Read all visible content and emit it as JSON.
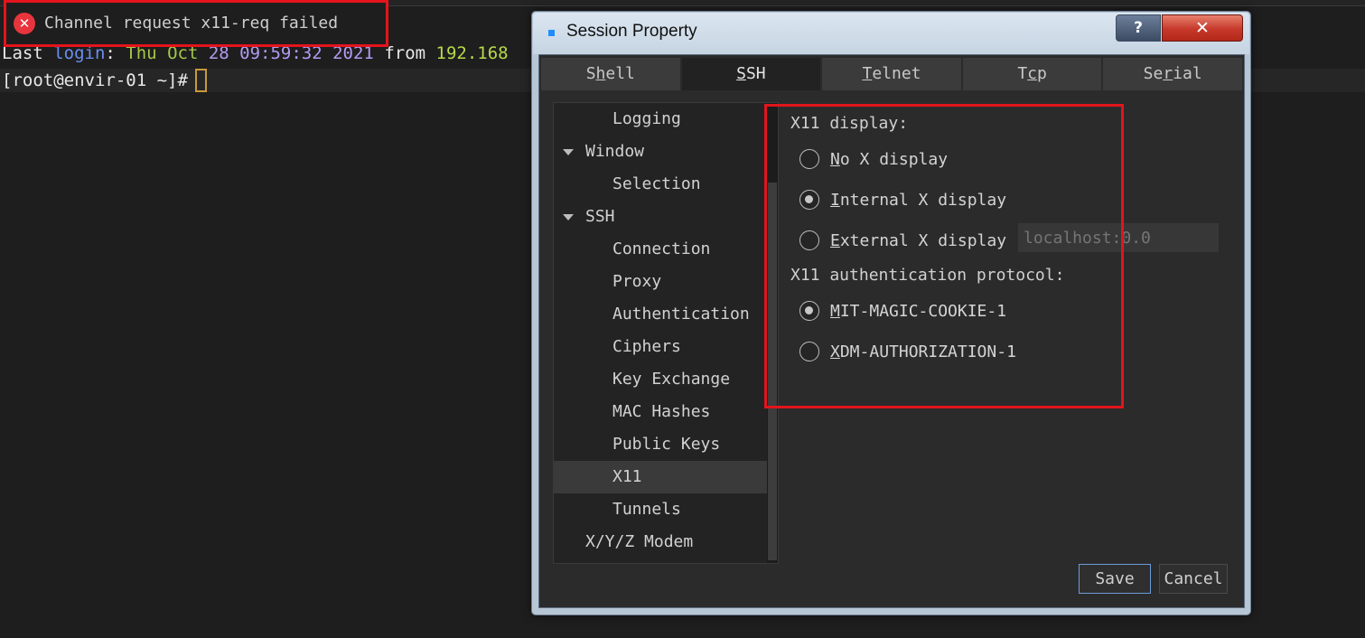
{
  "terminal": {
    "toast_text": "Channel request x11-req failed",
    "login_line": {
      "last": "Last ",
      "login": "login",
      "colon": ": ",
      "day": "Thu ",
      "month": "Oct ",
      "date": "28 ",
      "time": "09:59:32 ",
      "year": "2021 ",
      "from": "from ",
      "ip": "192.168"
    },
    "prompt": "[root@envir-01 ~]#"
  },
  "dialog": {
    "title": "Session Property",
    "help_label": "?",
    "close_label": "✕",
    "tabs": [
      {
        "pre": "S",
        "ul": "h",
        "post": "ell"
      },
      {
        "pre": "",
        "ul": "S",
        "post": "SH"
      },
      {
        "pre": "",
        "ul": "T",
        "post": "elnet"
      },
      {
        "pre": "T",
        "ul": "c",
        "post": "p"
      },
      {
        "pre": "Se",
        "ul": "r",
        "post": "ial"
      }
    ],
    "tree": [
      "Logging",
      "Window",
      "Selection",
      "SSH",
      "Connection",
      "Proxy",
      "Authentication",
      "Ciphers",
      "Key Exchange",
      "MAC Hashes",
      "Public Keys",
      "X11",
      "Tunnels",
      "X/Y/Z Modem"
    ],
    "x11_display_label": "X11 display:",
    "display_options": [
      {
        "ul": "N",
        "rest": "o X display"
      },
      {
        "ul": "I",
        "rest": "nternal X display"
      },
      {
        "ul": "E",
        "rest": "xternal X display"
      }
    ],
    "external_host_placeholder": "localhost:0.0",
    "auth_label": "X11 authentication protocol:",
    "auth_options": [
      {
        "ul": "M",
        "rest": "IT-MAGIC-COOKIE-1"
      },
      {
        "ul": "X",
        "rest": "DM-AUTHORIZATION-1"
      }
    ],
    "save_label": "Save",
    "cancel_label": "Cancel"
  },
  "colors": {
    "annotation_red": "#e3141c",
    "accent_blue": "#1f8dff"
  }
}
